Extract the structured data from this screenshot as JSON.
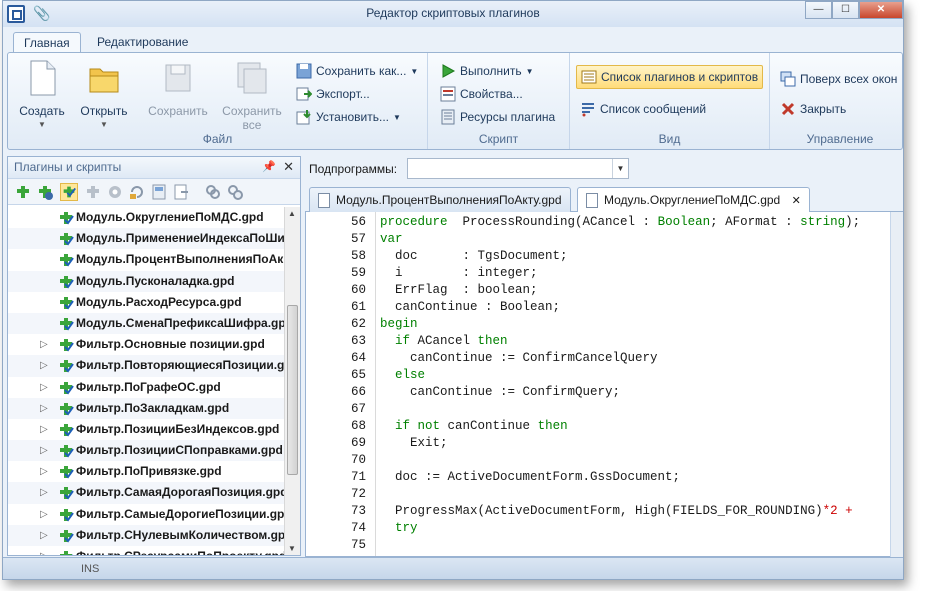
{
  "window": {
    "title": "Редактор скриптовых плагинов"
  },
  "ribbon": {
    "tabs": [
      {
        "label": "Главная",
        "active": true
      },
      {
        "label": "Редактирование",
        "active": false
      }
    ],
    "groups": {
      "file": {
        "label": "Файл",
        "create": "Создать",
        "open": "Открыть",
        "save": "Сохранить",
        "save_all": "Сохранить все",
        "save_as": "Сохранить как...",
        "export": "Экспорт...",
        "install": "Установить..."
      },
      "script": {
        "label": "Скрипт",
        "run": "Выполнить",
        "properties": "Свойства...",
        "resources": "Ресурсы плагина"
      },
      "view": {
        "label": "Вид",
        "plugin_list": "Список плагинов и скриптов",
        "message_list": "Список сообщений"
      },
      "manage": {
        "label": "Управление",
        "topmost": "Поверх всех окон",
        "close": "Закрыть"
      }
    }
  },
  "left_panel": {
    "title": "Плагины и скрипты",
    "items": [
      {
        "label": "Модуль.ОкруглениеПоМДС.gpd",
        "expandable": false
      },
      {
        "label": "Модуль.ПрименениеИндексаПоШи",
        "expandable": false
      },
      {
        "label": "Модуль.ПроцентВыполненияПоАк",
        "expandable": false
      },
      {
        "label": "Модуль.Пусконаладка.gpd",
        "expandable": false
      },
      {
        "label": "Модуль.РасходРесурса.gpd",
        "expandable": false
      },
      {
        "label": "Модуль.СменаПрефиксаШифра.gpc",
        "expandable": false
      },
      {
        "label": "Фильтр.Основные позиции.gpd",
        "expandable": true
      },
      {
        "label": "Фильтр.ПовторяющиесяПозиции.gpi",
        "expandable": true
      },
      {
        "label": "Фильтр.ПоГрафеОС.gpd",
        "expandable": true
      },
      {
        "label": "Фильтр.ПоЗакладкам.gpd",
        "expandable": true
      },
      {
        "label": "Фильтр.ПозицииБезИндексов.gpd",
        "expandable": true
      },
      {
        "label": "Фильтр.ПозицииСПоправками.gpd",
        "expandable": true
      },
      {
        "label": "Фильтр.ПоПривязке.gpd",
        "expandable": true
      },
      {
        "label": "Фильтр.СамаяДорогаяПозиция.gpd",
        "expandable": true
      },
      {
        "label": "Фильтр.СамыеДорогиеПозиции.gpc",
        "expandable": true
      },
      {
        "label": "Фильтр.СНулевымКоличеством.gpc",
        "expandable": true
      },
      {
        "label": "Фильтр.СРесурсамиПоПроекту.gpd",
        "expandable": true
      }
    ]
  },
  "subprograms": {
    "label": "Подпрограммы:",
    "value": ""
  },
  "editor_tabs": [
    {
      "label": "Модуль.ПроцентВыполненияПоАкту.gpd",
      "active": false
    },
    {
      "label": "Модуль.ОкруглениеПоМДС.gpd",
      "active": true
    }
  ],
  "code_lines": [
    {
      "num": "56",
      "tokens": [
        [
          "kw",
          "procedure"
        ],
        [
          "",
          "  ProcessRounding(ACancel : "
        ],
        [
          "ty",
          "Boolean"
        ],
        [
          "",
          "; AFormat : "
        ],
        [
          "ty",
          "string"
        ],
        [
          "",
          ");"
        ]
      ]
    },
    {
      "num": "57",
      "tokens": [
        [
          "kw",
          "var"
        ]
      ]
    },
    {
      "num": "58",
      "tokens": [
        [
          "",
          "  doc      : TgsDocument;"
        ]
      ]
    },
    {
      "num": "59",
      "tokens": [
        [
          "",
          "  i        : integer;"
        ]
      ]
    },
    {
      "num": "60",
      "tokens": [
        [
          "",
          "  ErrFlag  : boolean;"
        ]
      ]
    },
    {
      "num": "61",
      "tokens": [
        [
          "",
          "  canContinue : Boolean;"
        ]
      ]
    },
    {
      "num": "62",
      "tokens": [
        [
          "kw",
          "begin"
        ]
      ]
    },
    {
      "num": "63",
      "tokens": [
        [
          "",
          "  "
        ],
        [
          "kw",
          "if"
        ],
        [
          "",
          " ACancel "
        ],
        [
          "kw",
          "then"
        ]
      ]
    },
    {
      "num": "64",
      "tokens": [
        [
          "",
          "    canContinue := ConfirmCancelQuery"
        ]
      ]
    },
    {
      "num": "65",
      "tokens": [
        [
          "",
          "  "
        ],
        [
          "kw",
          "else"
        ]
      ]
    },
    {
      "num": "66",
      "tokens": [
        [
          "",
          "    canContinue := ConfirmQuery;"
        ]
      ]
    },
    {
      "num": "67",
      "tokens": [
        [
          "",
          ""
        ]
      ]
    },
    {
      "num": "68",
      "tokens": [
        [
          "",
          "  "
        ],
        [
          "kw",
          "if not"
        ],
        [
          "",
          " canContinue "
        ],
        [
          "kw",
          "then"
        ]
      ]
    },
    {
      "num": "69",
      "tokens": [
        [
          "",
          "    Exit;"
        ]
      ]
    },
    {
      "num": "70",
      "tokens": [
        [
          "",
          ""
        ]
      ]
    },
    {
      "num": "71",
      "tokens": [
        [
          "",
          "  doc := ActiveDocumentForm.GssDocument;"
        ]
      ]
    },
    {
      "num": "72",
      "tokens": [
        [
          "",
          ""
        ]
      ]
    },
    {
      "num": "73",
      "tokens": [
        [
          "",
          "  ProgressMax(ActiveDocumentForm, High(FIELDS_FOR_ROUNDING)"
        ],
        [
          "str",
          "*2 +"
        ]
      ]
    },
    {
      "num": "74",
      "tokens": [
        [
          "",
          "  "
        ],
        [
          "kw",
          "try"
        ]
      ]
    },
    {
      "num": "75",
      "tokens": [
        [
          "",
          ""
        ]
      ]
    }
  ],
  "status": {
    "mode": "INS"
  }
}
